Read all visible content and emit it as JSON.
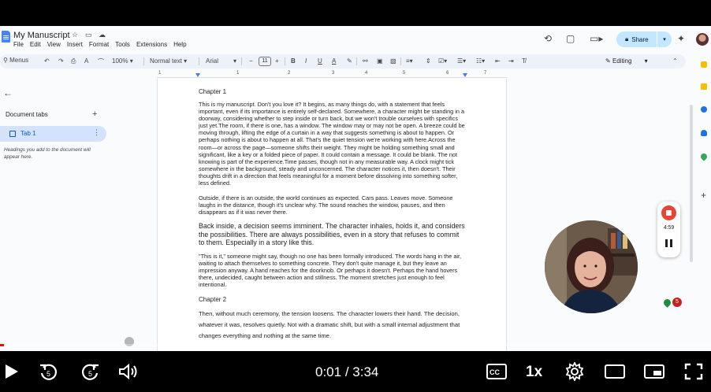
{
  "document": {
    "title": "My Manuscript",
    "menu": [
      "File",
      "Edit",
      "View",
      "Insert",
      "Format",
      "Tools",
      "Extensions",
      "Help"
    ],
    "share_label": "Share"
  },
  "toolbar": {
    "menus_label": "Menus",
    "zoom": "100%",
    "style": "Normal text",
    "font": "Arial",
    "font_size": "11",
    "mode": "Editing"
  },
  "ruler": {
    "numbers": [
      "1",
      "1",
      "2",
      "3",
      "4",
      "5",
      "6",
      "7"
    ]
  },
  "sidebar": {
    "section_label": "Document tabs",
    "tabs": [
      {
        "label": "Tab 1"
      }
    ],
    "hint": "Headings you add to the document will appear here."
  },
  "manuscript": {
    "chapter1": "Chapter 1",
    "para1": "This is my manuscript. Don't you love it? It begins, as many things do, with a statement that feels important, even if its importance is entirely self-declared. Somewhere, a character might be standing in a doorway, considering whether to step inside or turn back, but we won't trouble ourselves with specifics just yet.The room, if there is one, has a window. The window may or may not be open. A breeze could be moving through, lifting the edge of a curtain in a way that suggests something is about to happen. Or perhaps nothing is about to happen at all. That's the quiet tension we're working with here.Across the room—or across the page—someone shifts their weight. They might be holding something small and significant, like a key or a folded piece of paper. It could contain a message. It could be blank. The not knowing is part of the experience.Time passes, though not in any measurable way. A clock might tick somewhere in the background, steady and unconcerned. The character notices it, then doesn't. Their thoughts drift in a direction that feels meaningful for a moment before dissolving into something softer, less defined.",
    "para2": "Outside, if there is an outside, the world continues as expected. Cars pass. Leaves move. Someone laughs in the distance, though it's unclear why. The sound reaches the window, pauses, and then disappears as if it was never there.",
    "para3": "Back inside, a decision seems imminent. The character inhales, holds it, and considers the possibilities. There are always possibilities, even in a story that refuses to commit to them. Especially in a story like this.",
    "para4": "\"This is it,\" someone might say, though no one has been formally introduced. The words hang in the air, waiting to attach themselves to something concrete. They don't quite manage it, but they leave an impression anyway. A hand reaches for the doorknob. Or perhaps it doesn't. Perhaps the hand hovers there, undecided, caught between action and stillness. The moment stretches just enough to feel intentional.",
    "chapter2": "Chapter 2",
    "para5": "Then, without much ceremony, the tension loosens. The character lowers their hand. The decision, whatever it was, resolves quietly. Not with a dramatic shift, but with a small internal adjustment that changes everything and nothing at the same time."
  },
  "recorder": {
    "time": "4:59",
    "badge_count": "5"
  },
  "player": {
    "current_time": "0:01",
    "separator": " / ",
    "duration": "3:34",
    "speed": "1x",
    "progress": 0.005,
    "rewind_label": "5",
    "forward_label": "5"
  },
  "colors": {
    "share_bg": "#c2e7ff",
    "tab_active_bg": "#d3e3fd",
    "progress": "#ff0000",
    "record": "#ea4335"
  }
}
